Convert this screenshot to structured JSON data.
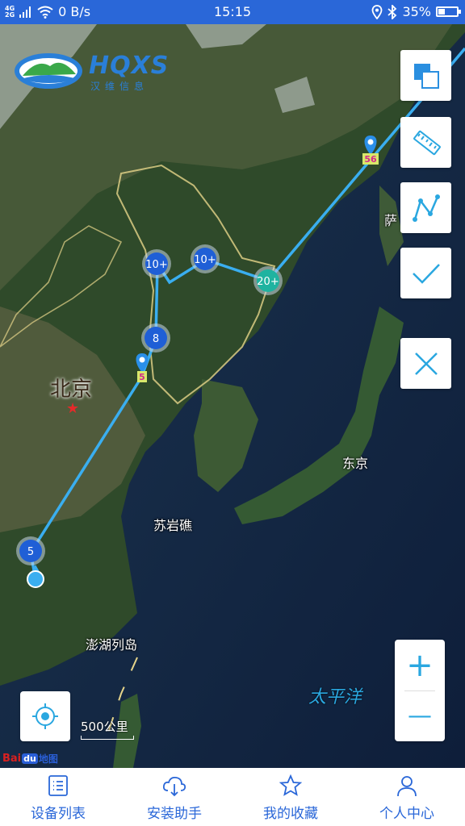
{
  "status_bar": {
    "network": [
      "4G",
      "2G"
    ],
    "data_speed": "0 B/s",
    "time": "15:15",
    "battery": "35%",
    "battery_level": 0.35
  },
  "logo": {
    "brand": "HQXS",
    "tagline": "汉维信息"
  },
  "map": {
    "labels": {
      "beijing": "北京",
      "tokyo": "东京",
      "suyan_reef": "苏岩礁",
      "penghu": "澎湖列岛",
      "pacific": "太平洋",
      "sakhalin_partial": "萨"
    },
    "clusters": [
      {
        "label": "10+",
        "color": "#1f5fd6"
      },
      {
        "label": "10+",
        "color": "#1f5fd6"
      },
      {
        "label": "20+",
        "color": "#1fb3a0"
      },
      {
        "label": "8",
        "color": "#1f5fd6"
      },
      {
        "label": "5",
        "color": "#1f5fd6"
      }
    ],
    "pins": [
      {
        "badge": "56"
      },
      {
        "badge": "5"
      }
    ],
    "scale": "500公里",
    "attribution": {
      "bai": "Bai",
      "du": "du",
      "map": "地图"
    }
  },
  "tools": [
    {
      "icon": "layers-icon"
    },
    {
      "icon": "ruler-icon"
    },
    {
      "icon": "polyline-icon"
    },
    {
      "icon": "check-icon"
    },
    {
      "icon": "close-icon"
    }
  ],
  "zoom": {
    "in": "+",
    "out": "—"
  },
  "bottom_nav": [
    {
      "label": "设备列表",
      "icon": "device-list-icon"
    },
    {
      "label": "安装助手",
      "icon": "cloud-icon"
    },
    {
      "label": "我的收藏",
      "icon": "star-icon"
    },
    {
      "label": "个人中心",
      "icon": "person-icon"
    }
  ],
  "colors": {
    "accent": "#2a67d8",
    "track": "#3aaef0",
    "cluster_blue": "#1f5fd6",
    "cluster_teal": "#1fb3a0"
  }
}
